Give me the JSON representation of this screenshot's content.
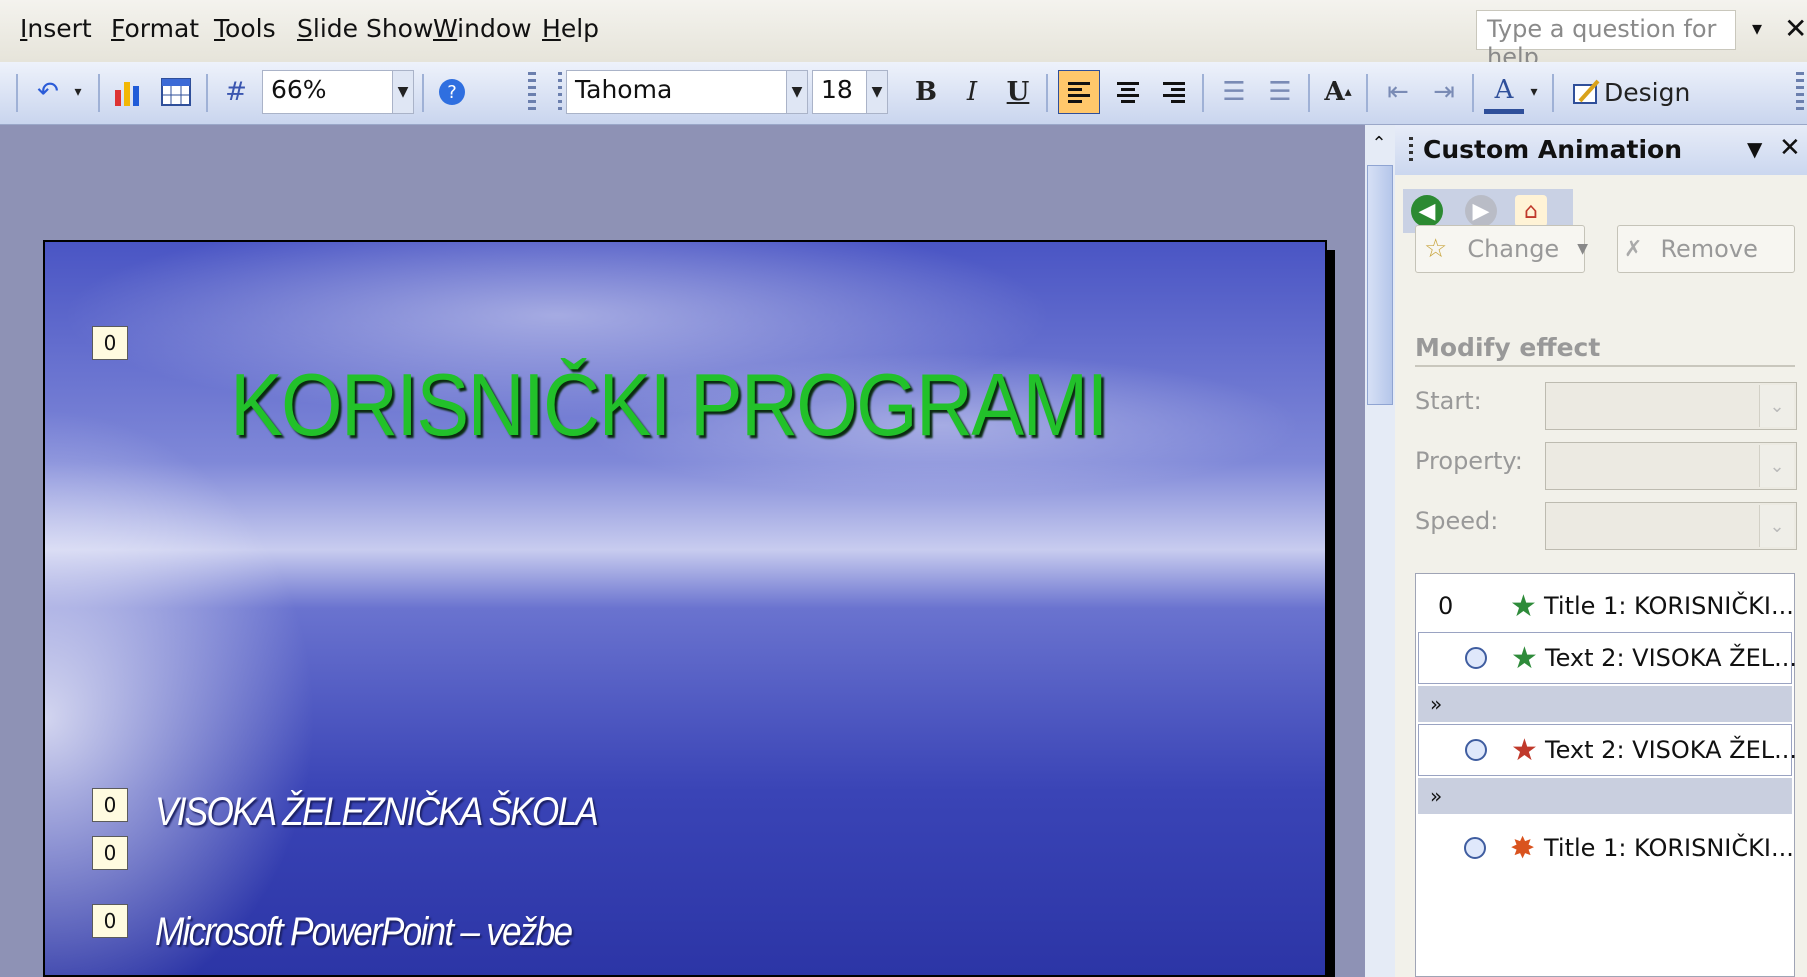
{
  "menu": {
    "items": [
      "Insert",
      "Format",
      "Tools",
      "Slide Show",
      "Window",
      "Help"
    ],
    "help_placeholder": "Type a question for help"
  },
  "toolbar": {
    "zoom": "66%",
    "font": "Tahoma",
    "font_size": "18",
    "bold": "B",
    "italic": "I",
    "underline": "U",
    "font_color_label": "A",
    "design_label": "Design",
    "icons": [
      "undo-icon",
      "chart-icon",
      "table-icon",
      "grid-icon",
      "help-icon",
      "grow-font-icon",
      "align-left-icon",
      "center-icon",
      "align-right-icon",
      "numbering-icon",
      "bullets-icon",
      "decrease-indent-icon",
      "increase-indent-icon",
      "font-color-icon",
      "design-icon"
    ]
  },
  "slide": {
    "title": "KORISNIČKI PROGRAMI",
    "line1": "VISOKA ŽELEZNIČKA ŠKOLA",
    "line2": "Microsoft PowerPoint – vežbe",
    "tags": [
      "0",
      "0",
      "0",
      "0"
    ],
    "colors": {
      "title": "#22c12a",
      "text": "#ffffff"
    }
  },
  "taskpane": {
    "title": "Custom Animation",
    "change_label": "Change",
    "remove_label": "Remove",
    "section": "Modify effect",
    "start_label": "Start:",
    "property_label": "Property:",
    "speed_label": "Speed:",
    "list": [
      {
        "num": "0",
        "text": "Title 1: KORISNIČKI...",
        "star": "green"
      },
      {
        "num": "",
        "text": "Text 2: VISOKA ŽEL...",
        "star": "green"
      },
      {
        "num": "",
        "text": "Text 2: VISOKA ŽEL...",
        "star": "red"
      },
      {
        "num": "",
        "text": "Title 1: KORISNIČKI...",
        "star": "red"
      }
    ]
  }
}
